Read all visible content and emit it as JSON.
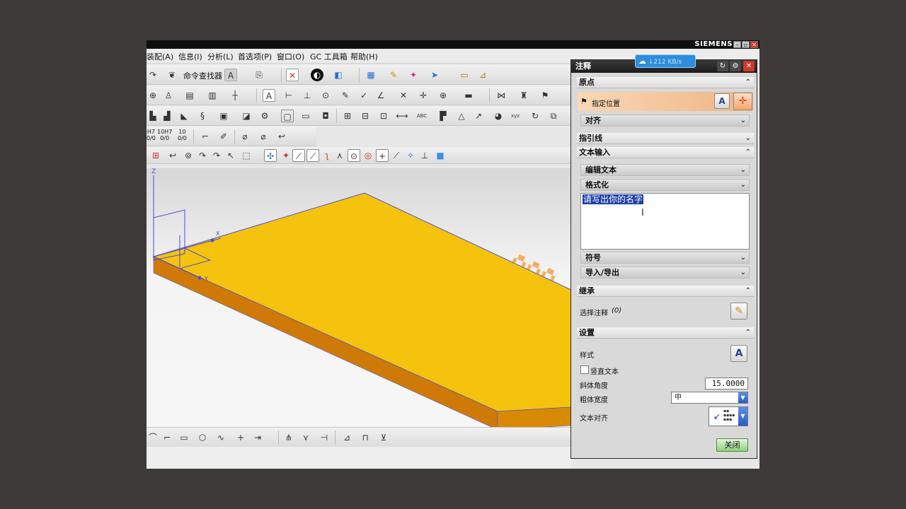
{
  "window": {
    "brand": "SIEMENS",
    "minimize": "–",
    "maximize": "▫",
    "close": "✕"
  },
  "menubar": {
    "items": [
      "装配(A)",
      "信息(I)",
      "分析(L)",
      "首选项(P)",
      "窗口(O)",
      "GC 工具箱",
      "帮助(H)"
    ]
  },
  "toolbar": {
    "command_finder_label": "命令查找器",
    "fits": [
      "H7",
      "10H7",
      "10"
    ],
    "fits_sub": [
      "0/0",
      "0/0",
      "0/0"
    ]
  },
  "viewport": {
    "axis_z": "Z",
    "axis_x": "X",
    "axis_y": "Y",
    "background_colors": [
      "#d7d7d7",
      "#f7f7f7"
    ],
    "part_top_color": "#f5c30e",
    "part_side_color": "#cf7a06",
    "edge_color": "#5555cc",
    "watermark_color": "#f39a36"
  },
  "network_badge": {
    "speed": "↓212 KB/s",
    "color": "#2f8cdb"
  },
  "dialog": {
    "title": "注释",
    "title_buttons": [
      "↻",
      "⚙",
      "✕"
    ],
    "sections": {
      "origin": {
        "title": "原点",
        "specify_location": "指定位置",
        "align": "对齐"
      },
      "leader": {
        "title": "指引线"
      },
      "text_input": {
        "title": "文本输入",
        "edit_text": "编辑文本",
        "format": "格式化",
        "text_value": "请写出你的名字",
        "symbols": "符号",
        "import_export": "导入/导出"
      },
      "inherit": {
        "title": "继承",
        "select_note": "选择注释",
        "select_count": "(0)"
      },
      "settings": {
        "title": "设置",
        "style": "样式",
        "vertical_text": "竖直文本",
        "italic_angle_label": "斜体角度",
        "italic_angle_value": "15.0000",
        "bold_width_label": "粗体宽度",
        "bold_width_value": "中",
        "text_align_label": "文本对齐"
      }
    },
    "close_button": "关闭"
  }
}
